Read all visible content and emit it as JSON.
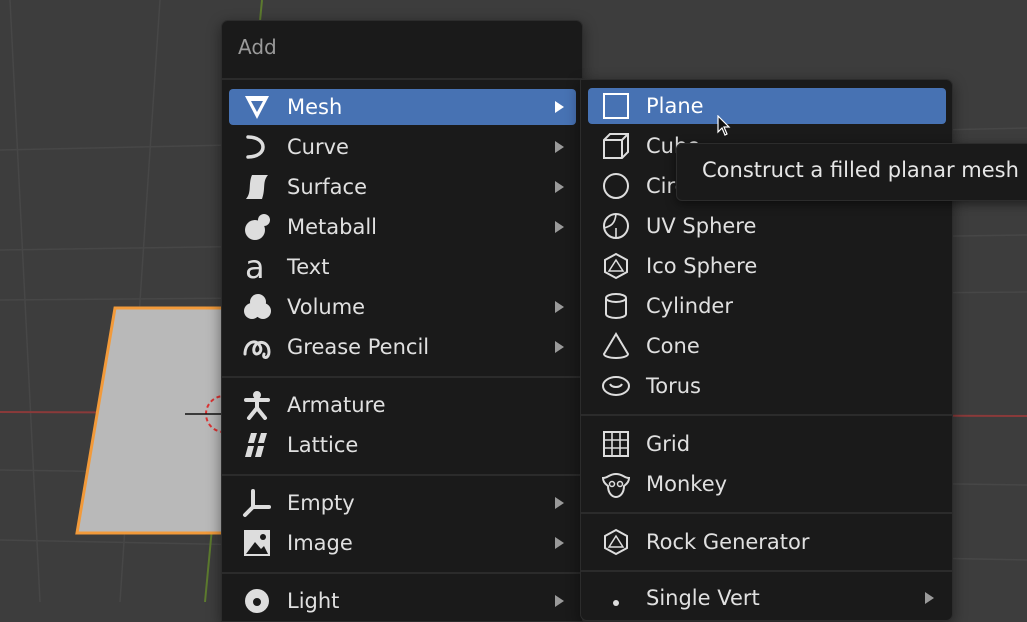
{
  "add_menu": {
    "title": "Add",
    "items": [
      {
        "label": "Mesh",
        "icon": "mesh-icon",
        "submenu": true,
        "active": true
      },
      {
        "label": "Curve",
        "icon": "curve-icon",
        "submenu": true
      },
      {
        "label": "Surface",
        "icon": "surface-icon",
        "submenu": true
      },
      {
        "label": "Metaball",
        "icon": "metaball-icon",
        "submenu": true
      },
      {
        "label": "Text",
        "icon": "text-icon",
        "submenu": false
      },
      {
        "label": "Volume",
        "icon": "volume-icon",
        "submenu": true
      },
      {
        "label": "Grease Pencil",
        "icon": "grease-pencil-icon",
        "submenu": true
      },
      {
        "label": "Armature",
        "icon": "armature-icon",
        "submenu": false
      },
      {
        "label": "Lattice",
        "icon": "lattice-icon",
        "submenu": false
      },
      {
        "label": "Empty",
        "icon": "empty-icon",
        "submenu": true
      },
      {
        "label": "Image",
        "icon": "image-icon",
        "submenu": true
      },
      {
        "label": "Light",
        "icon": "light-icon",
        "submenu": true
      }
    ]
  },
  "mesh_menu": {
    "items": [
      {
        "label": "Plane",
        "icon": "plane-icon",
        "active": true
      },
      {
        "label": "Cube",
        "icon": "cube-icon"
      },
      {
        "label": "Circle",
        "icon": "circle-icon"
      },
      {
        "label": "UV Sphere",
        "icon": "uv-sphere-icon"
      },
      {
        "label": "Ico Sphere",
        "icon": "ico-sphere-icon"
      },
      {
        "label": "Cylinder",
        "icon": "cylinder-icon"
      },
      {
        "label": "Cone",
        "icon": "cone-icon"
      },
      {
        "label": "Torus",
        "icon": "torus-icon"
      },
      {
        "label": "Grid",
        "icon": "grid-icon"
      },
      {
        "label": "Monkey",
        "icon": "monkey-icon"
      },
      {
        "label": "Rock Generator",
        "icon": "rock-icon"
      },
      {
        "label": "Single Vert",
        "icon": "vert-icon",
        "submenu": true
      }
    ]
  },
  "tooltip": {
    "text": "Construct a filled planar mesh"
  },
  "colors": {
    "menu_bg": "#1a1a1a",
    "highlight": "#4772b3",
    "viewport_bg": "#3d3d3d",
    "selection_outline": "#f29a3a",
    "plane_fill": "#b9b9b9"
  }
}
